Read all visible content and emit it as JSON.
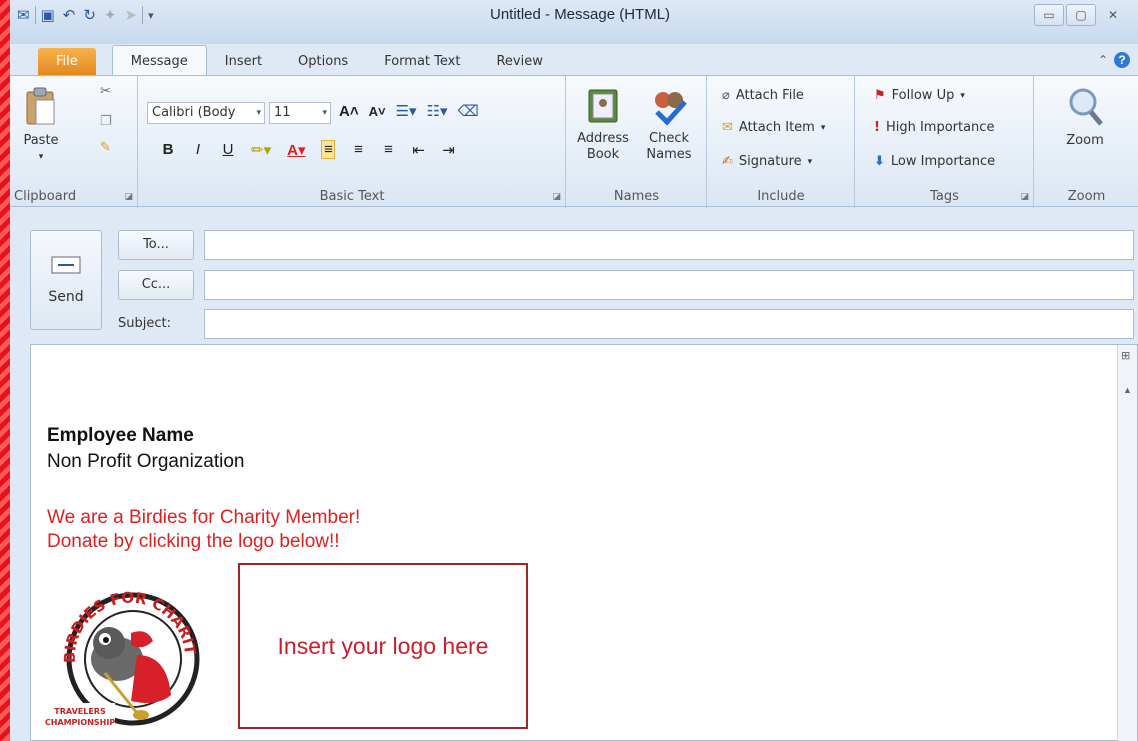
{
  "window": {
    "title": "Untitled - Message (HTML)"
  },
  "tabs": [
    {
      "label": "File"
    },
    {
      "label": "Message"
    },
    {
      "label": "Insert"
    },
    {
      "label": "Options"
    },
    {
      "label": "Format Text"
    },
    {
      "label": "Review"
    }
  ],
  "ribbon": {
    "clipboard": {
      "label": "Clipboard",
      "paste": "Paste"
    },
    "basic_text": {
      "label": "Basic Text",
      "font": "Calibri (Body",
      "size": "11"
    },
    "names": {
      "label": "Names",
      "address_book_1": "Address",
      "address_book_2": "Book",
      "check_names_1": "Check",
      "check_names_2": "Names"
    },
    "include": {
      "label": "Include",
      "attach_file": "Attach File",
      "attach_item": "Attach Item",
      "signature": "Signature"
    },
    "tags": {
      "label": "Tags",
      "follow_up": "Follow Up",
      "high_importance": "High Importance",
      "low_importance": "Low Importance"
    },
    "zoom": {
      "label": "Zoom",
      "button": "Zoom"
    }
  },
  "header": {
    "send": "Send",
    "to": "To...",
    "cc": "Cc...",
    "subject": "Subject:",
    "to_value": "",
    "cc_value": "",
    "subject_value": ""
  },
  "body": {
    "name": "Employee Name",
    "org": "Non Profit Organization",
    "line1": "We are a Birdies for Charity Member!",
    "line2": "Donate by clicking the logo below!!",
    "logo_text_top": "BIRDIES FOR CHARITY",
    "logo_text_bottom_1": "TRAVELERS",
    "logo_text_bottom_2": "CHAMPIONSHIP",
    "placeholder": "Insert your logo here"
  },
  "colors": {
    "accent_red": "#e02020",
    "file_tab": "#e3871e",
    "frame": "#e8101a"
  }
}
